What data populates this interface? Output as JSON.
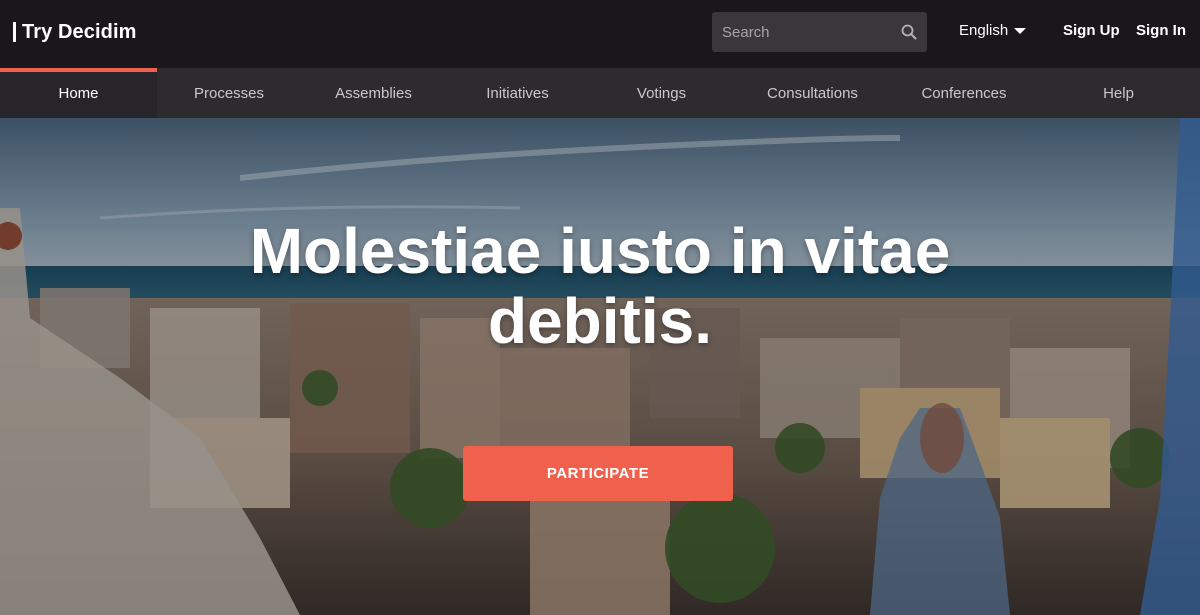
{
  "header": {
    "brand": "Try Decidim",
    "search_placeholder": "Search",
    "language": "English",
    "sign_up": "Sign Up",
    "sign_in": "Sign In"
  },
  "nav": {
    "items": [
      {
        "label": "Home",
        "active": true
      },
      {
        "label": "Processes",
        "active": false
      },
      {
        "label": "Assemblies",
        "active": false
      },
      {
        "label": "Initiatives",
        "active": false
      },
      {
        "label": "Votings",
        "active": false
      },
      {
        "label": "Consultations",
        "active": false
      },
      {
        "label": "Conferences",
        "active": false
      },
      {
        "label": "Help",
        "active": false
      }
    ]
  },
  "hero": {
    "title": "Molestiae iusto in vitae debitis.",
    "cta_label": "PARTICIPATE"
  },
  "colors": {
    "topbar": "#1a171b",
    "nav": "#2e2b2f",
    "accent": "#ef604d"
  }
}
